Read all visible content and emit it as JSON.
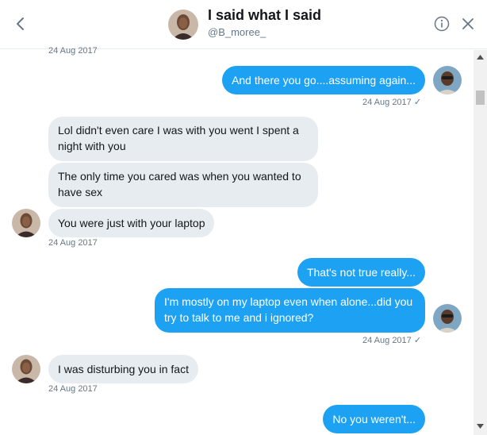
{
  "header": {
    "title": "I said what I said",
    "handle": "@B_moree_",
    "back_icon": "chevron-left-icon",
    "info_icon": "info-icon",
    "close_icon": "close-icon"
  },
  "messages": {
    "top_stamp": "24 Aug 2017",
    "m1": "And there you go....assuming again...",
    "m1_stamp": "24 Aug 2017",
    "m2": "Lol didn't even care I was with you went I spent a night with you",
    "m2_line1": "Lol didn't even care I was with you went I spent a",
    "m2_line2": "night with you",
    "m3_line1": "The only time you cared was when you wanted to",
    "m3_line2": "have sex",
    "m4": "You were just with your laptop",
    "m4_stamp": "24 Aug 2017",
    "m5": "That's not true really...",
    "m6_line1": "I'm mostly on my laptop even when alone...did you",
    "m6_line2": "try to talk to me and i ignored?",
    "m6_stamp": "24 Aug 2017",
    "m7": "I was disturbing you in fact",
    "m7_stamp": "24 Aug 2017",
    "m8": "No you weren't..."
  },
  "colors": {
    "outgoing": "#1da1f2",
    "incoming": "#e6ecf0",
    "muted": "#657786"
  }
}
